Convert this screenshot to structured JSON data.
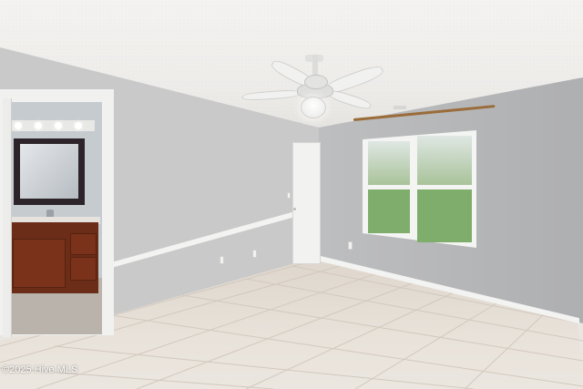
{
  "scene": {
    "description_hidden": "",
    "palette": {
      "wall": "#c9c9ca",
      "wall_side": "#b9babc",
      "ceiling": "#f1f0ee",
      "floor_tile": "#e5dfd7",
      "trim": "#f3f3f2",
      "vanity_wood": "#6b2c18",
      "curtain_rod": "#9a6c3a",
      "lawn": "#7fae6c"
    },
    "icons": [
      "ceiling-fan-icon"
    ]
  },
  "watermark": {
    "text": "©2025 Hive MLS"
  }
}
